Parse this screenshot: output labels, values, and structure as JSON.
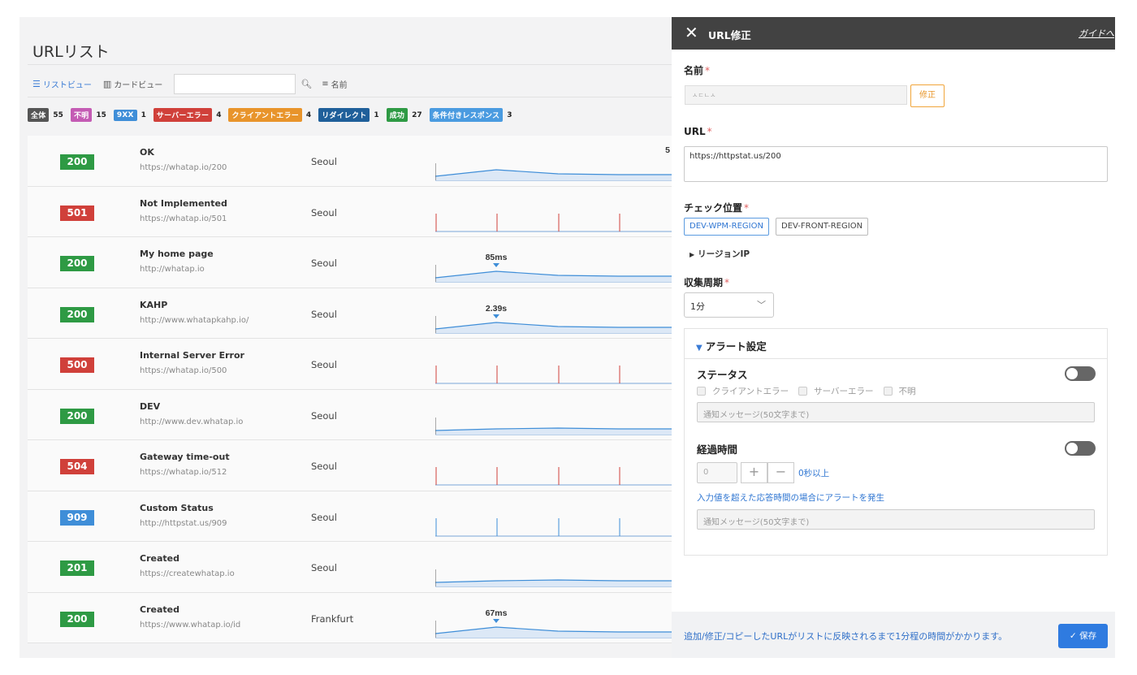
{
  "list": {
    "title": "URLリスト",
    "view_list_label": "リストビュー",
    "view_card_label": "カードビュー",
    "search_value": "",
    "sort_label": "名前",
    "filters": [
      {
        "label": "全体",
        "count": "55",
        "color": "#555555"
      },
      {
        "label": "不明",
        "count": "15",
        "color": "#c45bb4"
      },
      {
        "label": "9XX",
        "count": "1",
        "color": "#3f8ed8"
      },
      {
        "label": "サーバーエラー",
        "count": "4",
        "color": "#d0403a"
      },
      {
        "label": "クライアントエラー",
        "count": "4",
        "color": "#e8942b"
      },
      {
        "label": "リダイレクト",
        "count": "1",
        "color": "#1f5f9a"
      },
      {
        "label": "成功",
        "count": "27",
        "color": "#2e9a44"
      },
      {
        "label": "条件付きレスポンス",
        "count": "3",
        "color": "#4a9be0"
      }
    ],
    "rows": [
      {
        "code": "200",
        "color": "#2e9a44",
        "name": "OK",
        "url": "https://whatap.io/200",
        "location": "Seoul",
        "label": "5"
      },
      {
        "code": "501",
        "color": "#d0403a",
        "name": "Not Implemented",
        "url": "https://whatap.io/501",
        "location": "Seoul",
        "label": ""
      },
      {
        "code": "200",
        "color": "#2e9a44",
        "name": "My home page",
        "url": "http://whatap.io",
        "location": "Seoul",
        "label": "85ms"
      },
      {
        "code": "200",
        "color": "#2e9a44",
        "name": "KAHP",
        "url": "http://www.whatapkahp.io/",
        "location": "Seoul",
        "label": "2.39s"
      },
      {
        "code": "500",
        "color": "#d0403a",
        "name": "Internal Server Error",
        "url": "https://whatap.io/500",
        "location": "Seoul",
        "label": ""
      },
      {
        "code": "200",
        "color": "#2e9a44",
        "name": "DEV",
        "url": "http://www.dev.whatap.io",
        "location": "Seoul",
        "label": ""
      },
      {
        "code": "504",
        "color": "#d0403a",
        "name": "Gateway time-out",
        "url": "https://whatap.io/512",
        "location": "Seoul",
        "label": ""
      },
      {
        "code": "909",
        "color": "#3f8ed8",
        "name": "Custom Status",
        "url": "http://httpstat.us/909",
        "location": "Seoul",
        "label": ""
      },
      {
        "code": "201",
        "color": "#2e9a44",
        "name": "Created",
        "url": "https://createwhatap.io",
        "location": "Seoul",
        "label": ""
      },
      {
        "code": "200",
        "color": "#2e9a44",
        "name": "Created",
        "url": "https://www.whatap.io/id",
        "location": "Frankfurt",
        "label": "67ms"
      }
    ]
  },
  "panel": {
    "title": "URL修正",
    "guide_link": "ガイドへ",
    "name_label": "名前",
    "name_value": "ㅅㄷㄴㅅ",
    "edit_button": "修正",
    "url_label": "URL",
    "url_value": "https://httpstat.us/200",
    "check_location_label": "チェック位置",
    "regions": [
      "DEV-WPM-REGION",
      "DEV-FRONT-REGION"
    ],
    "region_ip_label": "リージョンIP",
    "interval_label": "収集周期",
    "interval_value": "1分",
    "alert": {
      "title": "アラート設定",
      "status_label": "ステータス",
      "status_options": [
        "クライアントエラー",
        "サーバーエラー",
        "不明"
      ],
      "message_placeholder": "通知メッセージ(50文字まで)",
      "elapsed_label": "経過時間",
      "elapsed_value": "0",
      "elapsed_suffix": "0秒以上",
      "elapsed_hint": "入力値を超えた応答時間の場合にアラートを発生"
    },
    "footer_note": "追加/修正/コピーしたURLがリストに反映されるまで1分程の時間がかかります。",
    "save_button": "保存"
  },
  "colors": {
    "accent": "#2f7be0",
    "header": "#424242",
    "success": "#2e9a44",
    "error": "#d0403a",
    "custom": "#3f8ed8"
  }
}
